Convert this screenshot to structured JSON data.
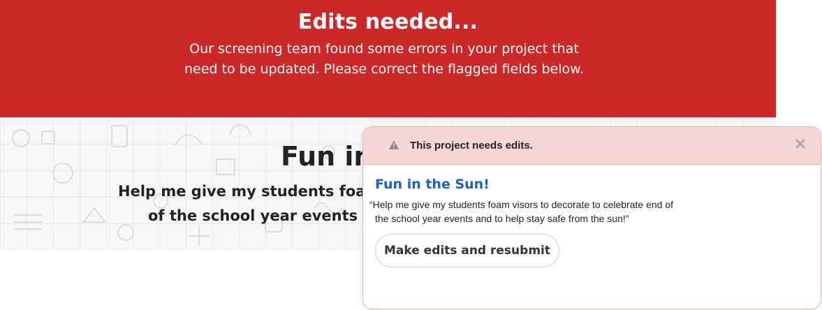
{
  "banner": {
    "title": "Edits needed...",
    "body": "Our screening team found some errors in your project that need to be updated. Please correct the flagged fields below.",
    "color": "#cd2828"
  },
  "background_project": {
    "title_partial": "Fun in",
    "subtitle_line1": "Help me give my students foa",
    "subtitle_line2": "of the school year events"
  },
  "modal": {
    "header_text": "This project needs edits.",
    "header_icon": "warning-icon",
    "close_icon": "close-icon",
    "project_title": "Fun in the Sun!",
    "project_quote": "“Help me give my students foam visors to decorate to celebrate end of the school year events and to help stay safe from the sun!”",
    "button_label": "Make edits and resubmit",
    "title_color": "#1a5fd0",
    "header_color": "#f7d6d6"
  }
}
